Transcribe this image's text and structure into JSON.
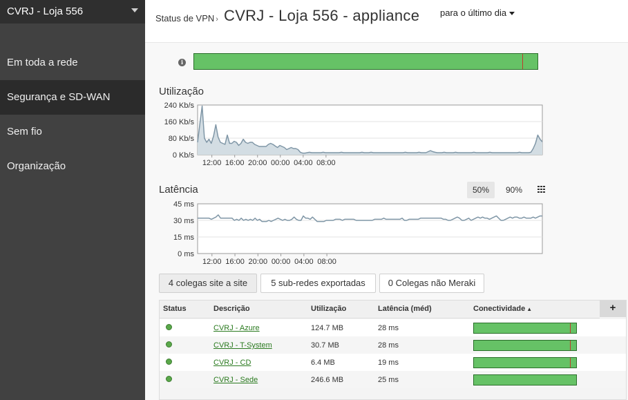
{
  "sidebar": {
    "network_name": "CVRJ - Loja 556",
    "items": [
      {
        "label": "Em toda a rede",
        "active": false
      },
      {
        "label": "Segurança e SD-WAN",
        "active": true
      },
      {
        "label": "Sem fio",
        "active": false
      },
      {
        "label": "Organização",
        "active": false
      }
    ]
  },
  "header": {
    "breadcrumb": "Status de VPN",
    "breadcrumb_separator": "›",
    "title": "CVRJ - Loja 556 - appliance",
    "time_range": "para o último dia"
  },
  "overview": {
    "connectivity_marks": [
      0.955
    ]
  },
  "utilization": {
    "title": "Utilização",
    "y_ticks": [
      "240 Kb/s",
      "160 Kb/s",
      "80 Kb/s",
      "0 Kb/s"
    ],
    "x_ticks": [
      "12:00",
      "16:00",
      "20:00",
      "00:00",
      "04:00",
      "08:00"
    ]
  },
  "latency": {
    "title": "Latência",
    "percentiles": [
      {
        "label": "50%",
        "active": true
      },
      {
        "label": "90%",
        "active": false
      }
    ],
    "y_ticks": [
      "45 ms",
      "30 ms",
      "15 ms",
      "0 ms"
    ],
    "x_ticks": [
      "12:00",
      "16:00",
      "20:00",
      "00:00",
      "04:00",
      "08:00"
    ]
  },
  "chart_data": [
    {
      "type": "area",
      "title": "Utilização",
      "ylabel": "Kb/s",
      "ylim": [
        0,
        240
      ],
      "x_start_hour": 9.5,
      "x_step_hours": 0.4,
      "x_ticks": [
        "12:00",
        "16:00",
        "20:00",
        "00:00",
        "04:00",
        "08:00"
      ],
      "color": "#7f96a6",
      "fill": "#d3dde3",
      "values": [
        60,
        150,
        235,
        80,
        60,
        75,
        55,
        90,
        145,
        85,
        60,
        55,
        50,
        95,
        55,
        55,
        65,
        60,
        45,
        55,
        75,
        60,
        55,
        60,
        60,
        50,
        45,
        40,
        40,
        40,
        40,
        50,
        55,
        50,
        42,
        35,
        45,
        40,
        35,
        25,
        30,
        35,
        30,
        30,
        25,
        12,
        8,
        8,
        10,
        12,
        10,
        10,
        10,
        10,
        10,
        12,
        10,
        10,
        10,
        10,
        10,
        10,
        10,
        12,
        10,
        10,
        10,
        10,
        10,
        10,
        10,
        10,
        12,
        10,
        10,
        10,
        12,
        10,
        10,
        10,
        10,
        10,
        10,
        10,
        10,
        10,
        10,
        10,
        10,
        10,
        10,
        12,
        10,
        10,
        10,
        10,
        10,
        12,
        10,
        10,
        10,
        15,
        20,
        15,
        12,
        10,
        10,
        10,
        12,
        10,
        10,
        10,
        10,
        12,
        10,
        10,
        10,
        10,
        10,
        10,
        10,
        12,
        10,
        10,
        10,
        10,
        10,
        10,
        12,
        10,
        10,
        10,
        10,
        10,
        10,
        10,
        10,
        10,
        10,
        10,
        10,
        12,
        10,
        10,
        10,
        10,
        12,
        30,
        55,
        95,
        75,
        62
      ]
    },
    {
      "type": "line",
      "title": "Latência",
      "ylabel": "ms",
      "ylim": [
        0,
        45
      ],
      "x_start_hour": 9.5,
      "x_step_hours": 0.4,
      "x_ticks": [
        "12:00",
        "16:00",
        "20:00",
        "00:00",
        "04:00",
        "08:00"
      ],
      "color": "#7f96a6",
      "values": [
        32,
        32,
        32,
        32,
        32,
        32,
        31,
        32,
        33,
        35,
        32,
        32,
        32,
        32,
        32,
        32,
        30,
        31,
        30,
        32,
        30,
        31,
        30,
        31,
        30,
        32,
        30,
        31,
        29,
        29,
        29,
        30,
        29,
        30,
        31,
        32,
        31,
        30,
        31,
        30,
        30,
        31,
        33,
        31,
        30,
        30,
        34,
        32,
        32,
        31,
        33,
        31,
        29,
        29,
        29,
        29,
        30,
        30,
        30,
        30,
        31,
        31,
        31,
        30,
        31,
        31,
        31,
        31,
        31,
        30,
        30,
        30,
        30,
        30,
        30,
        30,
        30,
        31,
        31,
        31,
        31,
        32,
        31,
        31,
        31,
        31,
        31,
        31,
        31,
        32,
        30,
        30,
        31,
        31,
        31,
        31,
        31,
        32,
        32,
        32,
        32,
        32,
        32,
        32,
        32,
        32,
        32,
        31,
        31,
        30,
        30,
        31,
        32,
        33,
        32,
        30,
        30,
        31,
        32,
        30,
        31,
        32,
        33,
        32,
        33,
        32,
        32,
        31,
        32,
        33,
        34,
        32,
        30,
        30,
        31,
        32,
        33,
        32,
        33,
        33,
        32,
        32,
        33,
        32,
        32,
        32,
        33,
        32,
        33,
        34,
        34
      ]
    }
  ],
  "tabs": [
    {
      "label": "4 colegas site a site",
      "active": true
    },
    {
      "label": "5 sub-redes exportadas",
      "active": false
    },
    {
      "label": "0 Colegas não Meraki",
      "active": false
    }
  ],
  "table": {
    "headers": {
      "status": "Status",
      "description": "Descrição",
      "utilization": "Utilização",
      "latency": "Latência (méd)",
      "connectivity": "Conectividade",
      "sort_arrow": "▲"
    },
    "add_column": "+",
    "rows": [
      {
        "name": "CVRJ - Azure",
        "utilization": "124.7 MB",
        "latency": "28 ms",
        "marks": [
          0.94
        ]
      },
      {
        "name": "CVRJ - T-System",
        "utilization": "30.7 MB",
        "latency": "28 ms",
        "marks": [
          0.94
        ]
      },
      {
        "name": "CVRJ - CD",
        "utilization": "6.4 MB",
        "latency": "19 ms",
        "marks": [
          0.94
        ]
      },
      {
        "name": "CVRJ - Sede",
        "utilization": "246.6 MB",
        "latency": "25 ms",
        "marks": []
      }
    ]
  },
  "colors": {
    "sidebar_bg": "#414141",
    "sidebar_active": "#2b2b2b",
    "conn_green": "#66c266",
    "conn_red": "#c0392b",
    "link_green": "#2a7a1f"
  }
}
